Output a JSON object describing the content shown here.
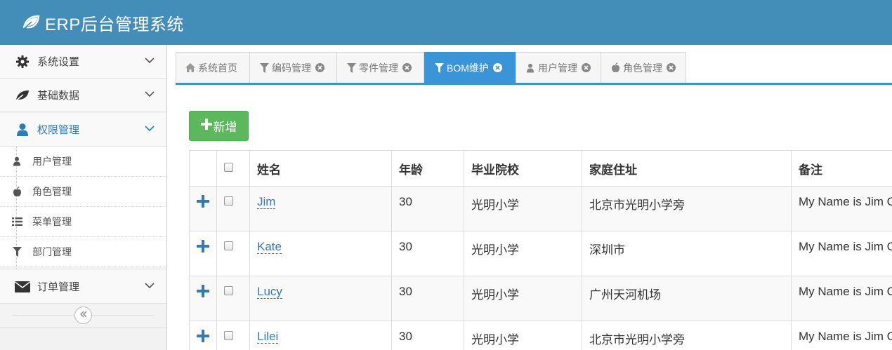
{
  "app": {
    "title": "ERP后台管理系统",
    "logo_icon": "leaf-icon"
  },
  "colors": {
    "header": "#438eb9",
    "accent": "#3a95d8",
    "add_button": "#5cb85c",
    "link": "#337ab7"
  },
  "sidebar": {
    "menus": [
      {
        "label": "系统设置",
        "icon": "gear-icon"
      },
      {
        "label": "基础数据",
        "icon": "leaf-icon"
      },
      {
        "label": "权限管理",
        "icon": "user-icon",
        "active": true
      },
      {
        "label": "订单管理",
        "icon": "envelope-icon"
      }
    ],
    "submenu": [
      {
        "label": "用户管理",
        "icon": "user-icon"
      },
      {
        "label": "角色管理",
        "icon": "apple-icon"
      },
      {
        "label": "菜单管理",
        "icon": "list-icon"
      },
      {
        "label": "部门管理",
        "icon": "filter-icon"
      }
    ],
    "collapse_icon": "double-chevron-left-icon"
  },
  "tabs": [
    {
      "label": "系统首页",
      "icon": "home-icon",
      "closable": false
    },
    {
      "label": "编码管理",
      "icon": "filter-icon",
      "closable": true
    },
    {
      "label": "零件管理",
      "icon": "filter-icon",
      "closable": true
    },
    {
      "label": "BOM维护",
      "icon": "filter-icon",
      "closable": true,
      "active": true
    },
    {
      "label": "用户管理",
      "icon": "user-icon",
      "closable": true
    },
    {
      "label": "角色管理",
      "icon": "apple-icon",
      "closable": true
    }
  ],
  "toolbar": {
    "add_label": "新增"
  },
  "table": {
    "columns": [
      "姓名",
      "年龄",
      "毕业院校",
      "家庭住址",
      "备注"
    ],
    "rows": [
      {
        "name": "Jim",
        "age": "30",
        "school": "光明小学",
        "address": "北京市光明小学旁",
        "note": "My Name is Jim C"
      },
      {
        "name": "Kate",
        "age": "30",
        "school": "光明小学",
        "address": "深圳市",
        "note": "My Name is Jim C"
      },
      {
        "name": "Lucy",
        "age": "30",
        "school": "光明小学",
        "address": "广州天河机场",
        "note": "My Name is Jim C"
      },
      {
        "name": "Lilei",
        "age": "30",
        "school": "光明小学",
        "address": "北京市光明小学旁",
        "note": "My Name is Jim C"
      }
    ]
  }
}
